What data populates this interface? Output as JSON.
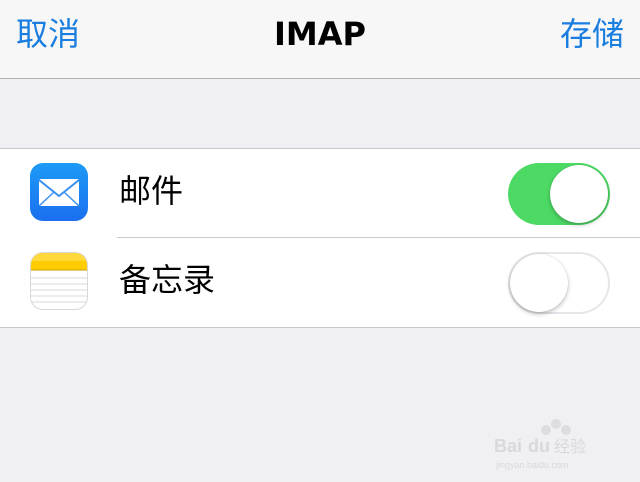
{
  "navbar": {
    "cancel_label": "取消",
    "title": "IMAP",
    "save_label": "存储"
  },
  "rows": [
    {
      "label": "邮件",
      "icon": "mail-icon",
      "enabled": true
    },
    {
      "label": "备忘录",
      "icon": "notes-icon",
      "enabled": false
    }
  ],
  "colors": {
    "accent": "#1a7ee0",
    "toggle_on": "#4cd964",
    "background": "#efeff4"
  },
  "watermark": {
    "brand": "Bai du 经验",
    "url": "jingyan.baidu.com"
  }
}
